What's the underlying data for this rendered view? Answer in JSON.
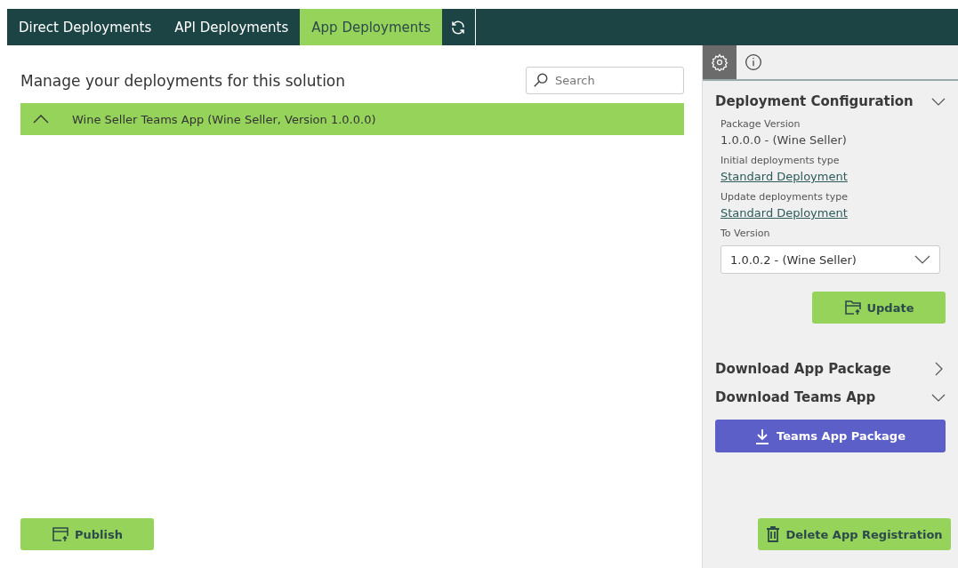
{
  "tabs": [
    {
      "label": "Direct Deployments",
      "selected": false
    },
    {
      "label": "API Deployments",
      "selected": false
    },
    {
      "label": "App Deployments",
      "selected": true
    }
  ],
  "heading": "Manage your deployments for this solution",
  "search": {
    "placeholder": "Search"
  },
  "deployments": [
    {
      "label": "Wine Seller Teams App (Wine Seller, Version 1.0.0.0)",
      "expanded": true
    }
  ],
  "publish_button": "Publish",
  "panel_tabs": [
    {
      "kind": "settings",
      "selected": true
    },
    {
      "kind": "info",
      "selected": false
    }
  ],
  "sections": [
    {
      "title": "Deployment Configuration",
      "expanded": true,
      "fields": [
        {
          "kind": "text",
          "label": "Package Version",
          "value": "1.0.0.0 - (Wine Seller)"
        },
        {
          "kind": "link",
          "label": "Initial deployments type",
          "value": "Standard Deployment"
        },
        {
          "kind": "link",
          "label": "Update deployments type",
          "value": "Standard Deployment"
        },
        {
          "kind": "select",
          "label": "To Version",
          "value": "1.0.0.2 - (Wine Seller)"
        }
      ],
      "button": {
        "kind": "update",
        "label": "Update"
      }
    },
    {
      "title": "Download App Package",
      "expanded": false
    },
    {
      "title": "Download Teams App",
      "expanded": true,
      "button": {
        "kind": "download",
        "label": "Teams App Package"
      }
    }
  ],
  "delete_button": "Delete App Registration"
}
